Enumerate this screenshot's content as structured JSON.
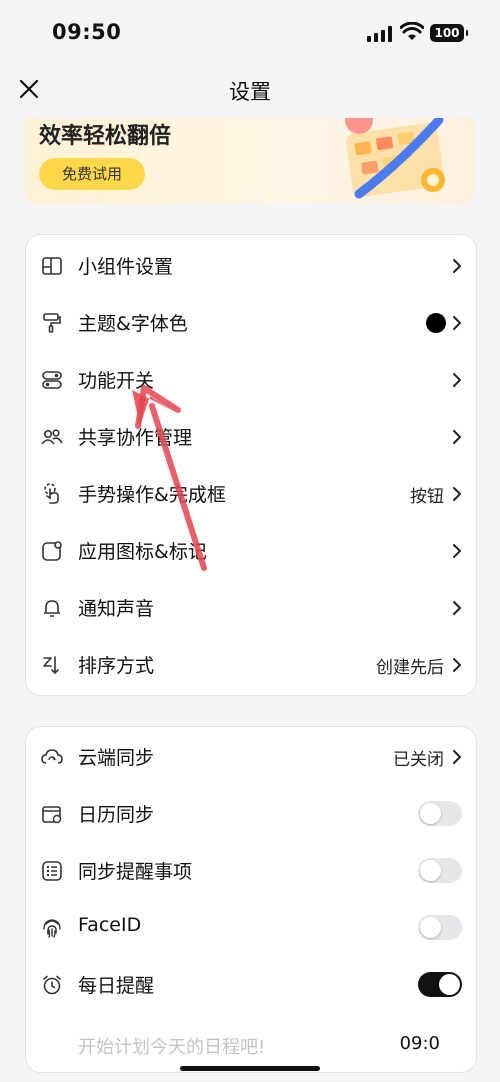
{
  "status": {
    "time": "09:50",
    "battery": "100"
  },
  "nav": {
    "title": "设置",
    "close_icon": "close-icon"
  },
  "promo": {
    "title": "效率轻松翻倍",
    "button": "免费试用"
  },
  "group1": [
    {
      "icon": "widget-icon",
      "label": "小组件设置",
      "value": ""
    },
    {
      "icon": "paint-roller-icon",
      "label": "主题&字体色",
      "value": ""
    },
    {
      "icon": "toggle-icon",
      "label": "功能开关",
      "value": ""
    },
    {
      "icon": "people-icon",
      "label": "共享协作管理",
      "value": ""
    },
    {
      "icon": "gesture-icon",
      "label": "手势操作&完成框",
      "value": "按钮"
    },
    {
      "icon": "app-icon",
      "label": "应用图标&标记",
      "value": ""
    },
    {
      "icon": "bell-icon",
      "label": "通知声音",
      "value": ""
    },
    {
      "icon": "sort-icon",
      "label": "排序方式",
      "value": "创建先后"
    }
  ],
  "group2": [
    {
      "icon": "cloud-sync-icon",
      "label": "云端同步",
      "value": "已关闭",
      "type": "chevron"
    },
    {
      "icon": "calendar-sync-icon",
      "label": "日历同步",
      "type": "toggle",
      "on": false
    },
    {
      "icon": "reminder-list-icon",
      "label": "同步提醒事项",
      "type": "toggle",
      "on": false
    },
    {
      "icon": "faceid-icon",
      "label": "FaceID",
      "type": "toggle",
      "on": false
    },
    {
      "icon": "alarm-icon",
      "label": "每日提醒",
      "type": "toggle",
      "on": true
    }
  ],
  "daily": {
    "hint": "开始计划今天的日程吧!",
    "time": "09:0"
  },
  "theme": {
    "dot_color": "#000000",
    "promo_button_color": "#ffd84a",
    "arrow_color": "#e8444e"
  }
}
